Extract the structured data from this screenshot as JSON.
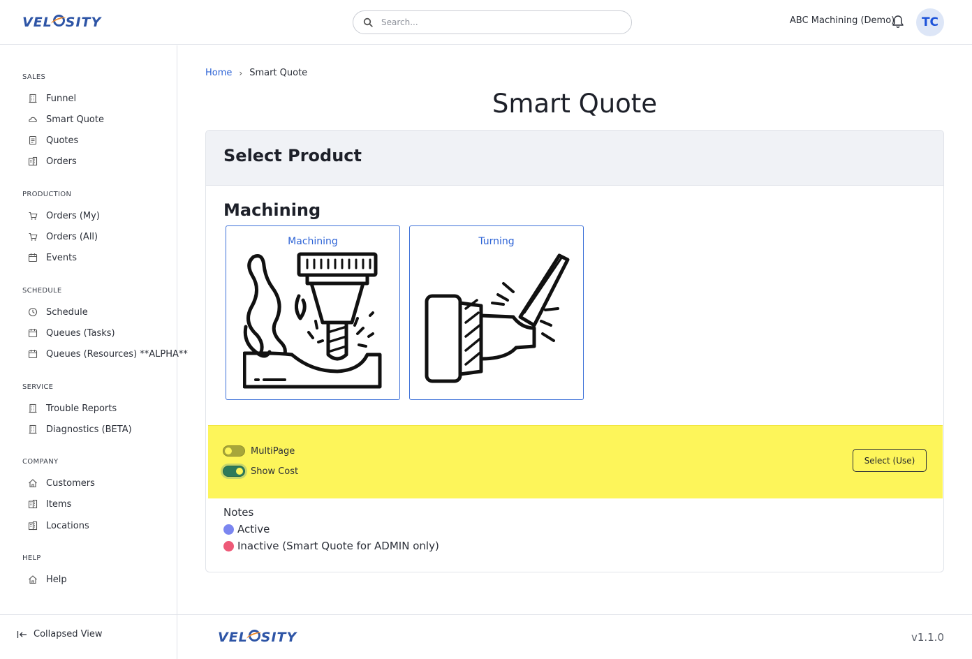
{
  "brand": {
    "logo_text_a": "VEL",
    "logo_text_b": "SITY"
  },
  "header": {
    "search_placeholder": "Search...",
    "company": "ABC Machining (Demo)",
    "avatar_initials": "TC"
  },
  "sidebar": {
    "sections": [
      {
        "title": "SALES",
        "items": [
          {
            "label": "Funnel",
            "icon": "building-icon"
          },
          {
            "label": "Smart Quote",
            "icon": "cloud-icon"
          },
          {
            "label": "Quotes",
            "icon": "document-icon"
          },
          {
            "label": "Orders",
            "icon": "buildings-icon"
          }
        ]
      },
      {
        "title": "PRODUCTION",
        "items": [
          {
            "label": "Orders (My)",
            "icon": "cart-icon"
          },
          {
            "label": "Orders (All)",
            "icon": "cart-icon"
          },
          {
            "label": "Events",
            "icon": "calendar-icon"
          }
        ]
      },
      {
        "title": "SCHEDULE",
        "items": [
          {
            "label": "Schedule",
            "icon": "clock-icon"
          },
          {
            "label": "Queues (Tasks)",
            "icon": "calendar-icon"
          },
          {
            "label": "Queues (Resources) **ALPHA**",
            "icon": "calendar-icon"
          }
        ]
      },
      {
        "title": "SERVICE",
        "items": [
          {
            "label": "Trouble Reports",
            "icon": "building-icon"
          },
          {
            "label": "Diagnostics (BETA)",
            "icon": "building-icon"
          }
        ]
      },
      {
        "title": "COMPANY",
        "items": [
          {
            "label": "Customers",
            "icon": "home-icon"
          },
          {
            "label": "Items",
            "icon": "buildings-icon"
          },
          {
            "label": "Locations",
            "icon": "buildings-icon"
          }
        ]
      },
      {
        "title": "HELP",
        "items": [
          {
            "label": "Help",
            "icon": "home-icon"
          }
        ]
      }
    ],
    "collapse_label": "Collapsed View"
  },
  "breadcrumb": {
    "home": "Home",
    "separator": "›",
    "current": "Smart Quote"
  },
  "page": {
    "title": "Smart Quote",
    "card_title": "Select Product",
    "group_title": "Machining",
    "products": [
      {
        "label": "Machining",
        "icon": "milling-machine-icon"
      },
      {
        "label": "Turning",
        "icon": "lathe-turning-icon"
      }
    ],
    "options": {
      "multipage_label": "MultiPage",
      "multipage_on": false,
      "show_cost_label": "Show Cost",
      "show_cost_on": true,
      "select_button": "Select (Use)",
      "highlight_color": "#fdf55a"
    },
    "notes": {
      "title": "Notes",
      "active": "Active",
      "active_color": "#7b86f0",
      "inactive": "Inactive (Smart Quote for ADMIN only)",
      "inactive_color": "#ee5a78"
    }
  },
  "footer": {
    "version": "v1.1.0"
  },
  "colors": {
    "accent": "#2d63d6",
    "brand": "#2e55a6",
    "brand_orange": "#f08a2a"
  }
}
